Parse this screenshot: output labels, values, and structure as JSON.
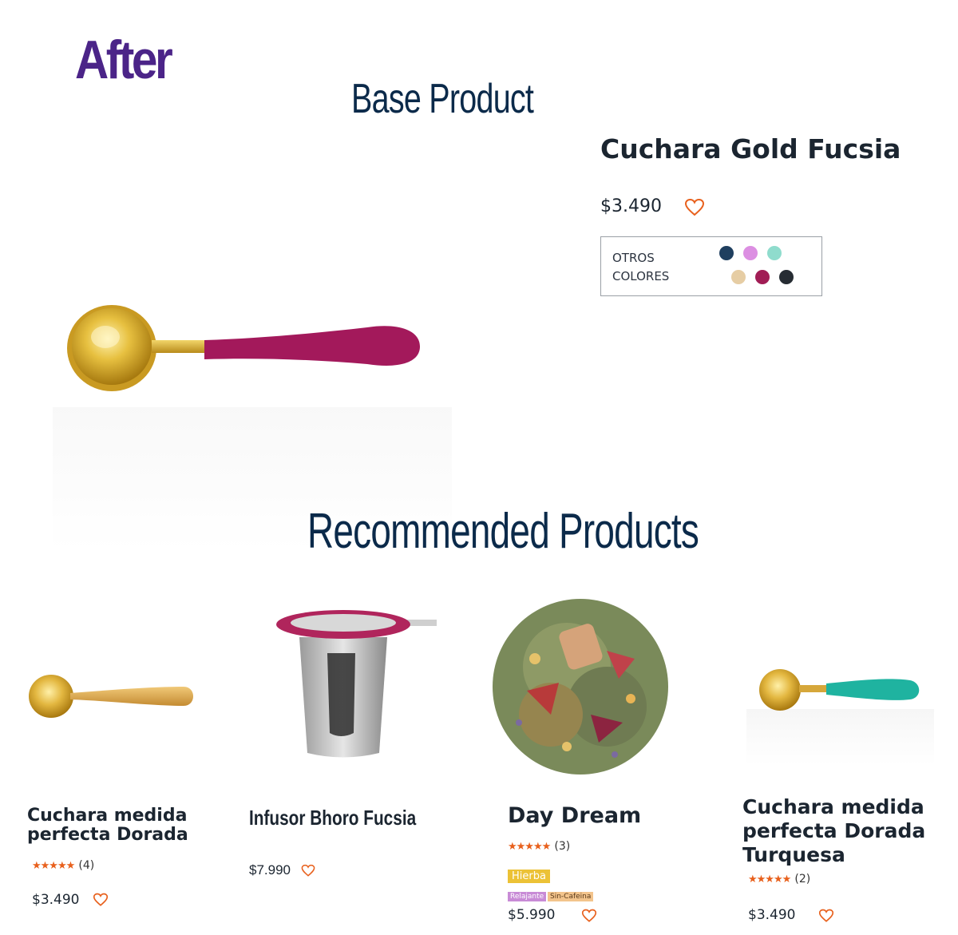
{
  "header": {
    "after_label": "After",
    "base_section_title": "Base Product",
    "recommended_section_title": "Recommended Products"
  },
  "base_product": {
    "name": "Cuchara Gold Fucsia",
    "price": "$3.490",
    "other_colors_label_line1": "OTROS",
    "other_colors_label_line2": "COLORES",
    "swatches": [
      "#1f3f5f",
      "#dc8fe2",
      "#8fdccd",
      "#e6cda4",
      "#a11d55",
      "#262c33"
    ],
    "handle_color": "#a3195b"
  },
  "recommended": [
    {
      "name_line1": "Cuchara medida",
      "name_line2": "perfecta Dorada",
      "stars": "★★★★★",
      "rating_count": "(4)",
      "price": "$3.490"
    },
    {
      "name_line1": "Infusor Bhoro Fucsia",
      "price": "$7.990"
    },
    {
      "name_line1": "Day Dream",
      "stars": "★★★★★",
      "rating_count": "(3)",
      "tag_main": "Hierba",
      "tag_1": "Relajante",
      "tag_2": "Sin-Cafeina",
      "price": "$5.990"
    },
    {
      "name_line1": "Cuchara medida",
      "name_line2": "perfecta Dorada",
      "name_line3": "Turquesa",
      "stars": "★★★★★",
      "rating_count": "(2)",
      "price": "$3.490"
    }
  ],
  "colors": {
    "accent_orange": "#e8601c",
    "tag_yellow": "#ecc236",
    "tag_lilac": "#c88bd6",
    "tag_peach": "#f3c48c"
  }
}
